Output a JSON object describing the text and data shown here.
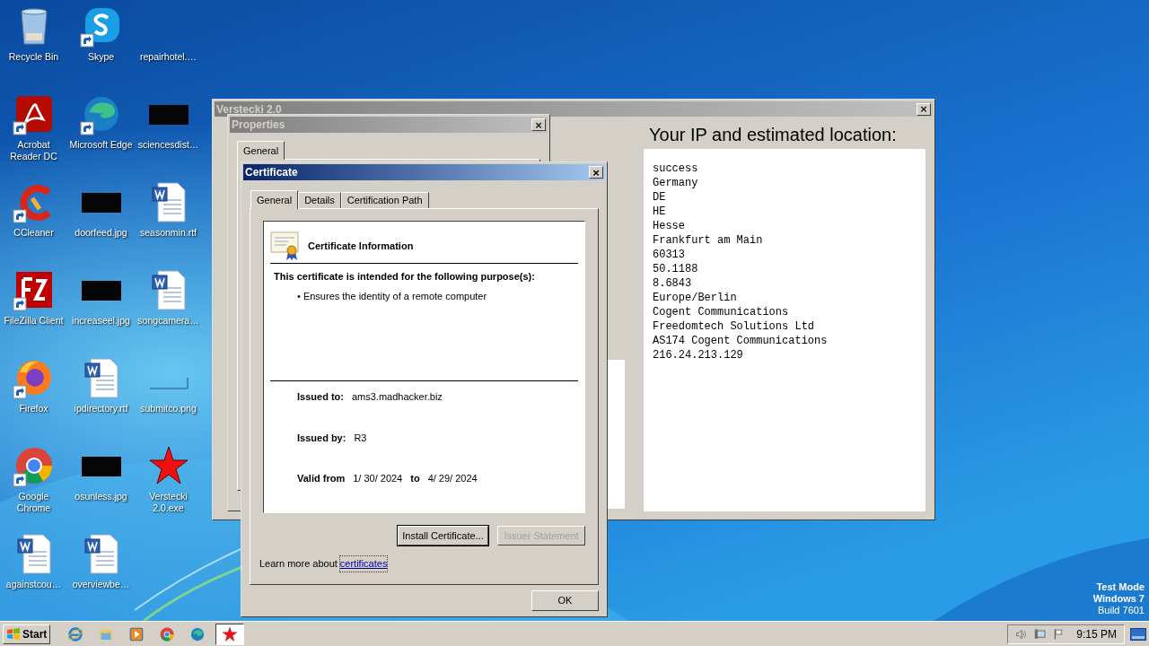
{
  "desktop": {
    "icons": [
      {
        "label": "Recycle Bin",
        "kind": "recycle",
        "shortcut": false
      },
      {
        "label": "Acrobat Reader DC",
        "kind": "acrobat",
        "shortcut": true
      },
      {
        "label": "CCleaner",
        "kind": "ccleaner",
        "shortcut": true
      },
      {
        "label": "FileZilla Client",
        "kind": "filezilla",
        "shortcut": true
      },
      {
        "label": "Firefox",
        "kind": "firefox",
        "shortcut": true
      },
      {
        "label": "Google Chrome",
        "kind": "chrome",
        "shortcut": true
      },
      {
        "label": "againstcou…",
        "kind": "word",
        "shortcut": false
      },
      {
        "label": "Skype",
        "kind": "skype",
        "shortcut": true
      },
      {
        "label": "Microsoft Edge",
        "kind": "edge",
        "shortcut": true
      },
      {
        "label": "doorfeed.jpg",
        "kind": "thumb",
        "shortcut": false
      },
      {
        "label": "increaseel.jpg",
        "kind": "thumb",
        "shortcut": false
      },
      {
        "label": "ipdirectory.rtf",
        "kind": "word",
        "shortcut": false
      },
      {
        "label": "osunless.jpg",
        "kind": "thumb",
        "shortcut": false
      },
      {
        "label": "overviewbe…",
        "kind": "word",
        "shortcut": false
      },
      {
        "label": "repairhotel.…",
        "kind": "blank",
        "shortcut": false
      },
      {
        "label": "sciencesdist…",
        "kind": "thumb",
        "shortcut": false
      },
      {
        "label": "seasonmin.rtf",
        "kind": "word",
        "shortcut": false
      },
      {
        "label": "songcamera…",
        "kind": "word",
        "shortcut": false
      },
      {
        "label": "submitco.png",
        "kind": "blank",
        "shortcut": false
      },
      {
        "label": "Verstecki 2.0.exe",
        "kind": "star",
        "shortcut": false
      }
    ]
  },
  "app_window": {
    "title": "Verstecki 2.0",
    "close": "×",
    "heading": "Your IP and estimated location:",
    "lines": [
      "success",
      "Germany",
      "DE",
      "HE",
      "Hesse",
      "Frankfurt am Main",
      "60313",
      "50.1188",
      "8.6843",
      "Europe/Berlin",
      "Cogent Communications",
      "Freedomtech Solutions Ltd",
      "AS174 Cogent Communications",
      "216.24.213.129"
    ]
  },
  "properties_window": {
    "title": "Properties",
    "close": "×",
    "tabs": [
      {
        "label": "General",
        "selected": true
      }
    ]
  },
  "certificate_dialog": {
    "title": "Certificate",
    "close": "×",
    "tabs": [
      {
        "label": "General",
        "selected": true
      },
      {
        "label": "Details",
        "selected": false
      },
      {
        "label": "Certification Path",
        "selected": false
      }
    ],
    "info_title": "Certificate Information",
    "purpose_heading": "This certificate is intended for the following purpose(s):",
    "purposes": [
      "• Ensures the identity of a remote computer"
    ],
    "issued_to_label": "Issued to:",
    "issued_to": "ams3.madhacker.biz",
    "issued_by_label": "Issued by:",
    "issued_by": "R3",
    "valid_from_label": "Valid from",
    "valid_from": "1/ 30/ 2024",
    "valid_to_label": "to",
    "valid_to": "4/ 29/ 2024",
    "buttons": [
      {
        "label": "Install Certificate...",
        "disabled": false
      },
      {
        "label": "Issuer Statement",
        "disabled": true
      }
    ],
    "learn_more": "Learn more about",
    "learn_more_link": "certificates",
    "ok": "OK"
  },
  "os_notice": [
    "Test Mode",
    "Windows 7",
    "Build 7601"
  ],
  "taskbar": {
    "start": "Start",
    "buttons": [
      {
        "kind": "ie",
        "active": false
      },
      {
        "kind": "explorer",
        "active": false
      },
      {
        "kind": "media",
        "active": false
      },
      {
        "kind": "chrome",
        "active": false
      },
      {
        "kind": "edge",
        "active": false
      },
      {
        "kind": "star",
        "active": true
      }
    ],
    "time": "9:15 PM"
  }
}
